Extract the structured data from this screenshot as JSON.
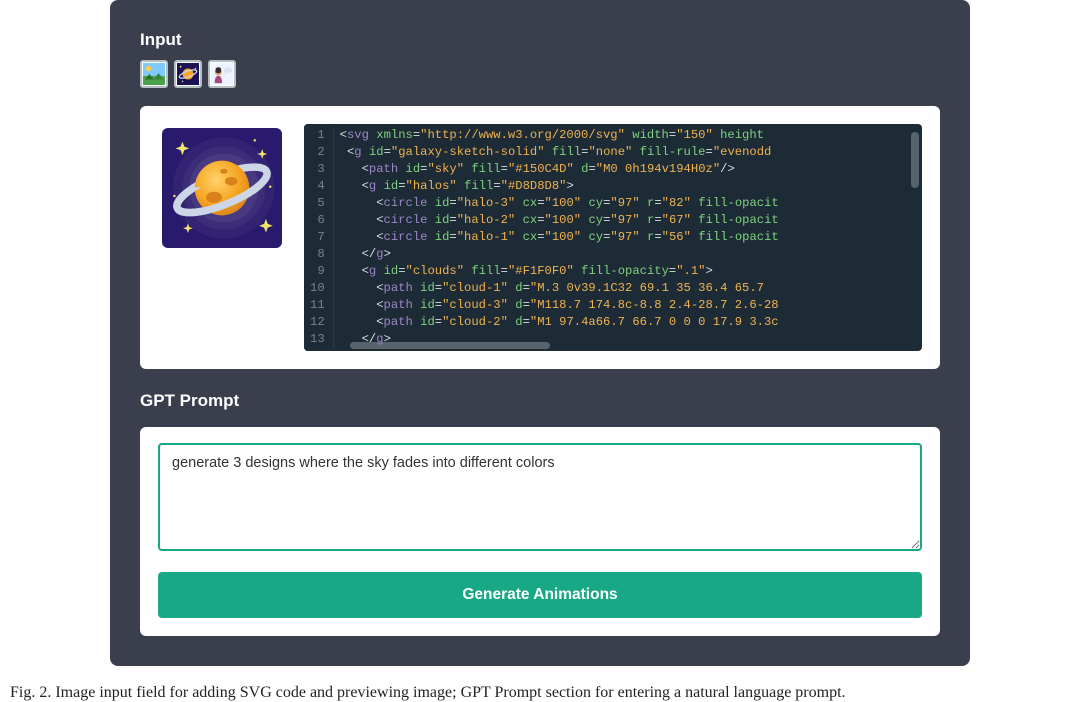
{
  "sections": {
    "input_label": "Input",
    "prompt_label": "GPT Prompt"
  },
  "thumbs": {
    "t1_name": "landscape-scene-icon",
    "t2_name": "galaxy-planet-icon",
    "t3_name": "person-speech-icon"
  },
  "code": {
    "line_numbers": [
      "1",
      "2",
      "3",
      "4",
      "5",
      "6",
      "7",
      "8",
      "9",
      "10",
      "11",
      "12",
      "13"
    ],
    "lines_plain": [
      "<svg xmlns=\"http://www.w3.org/2000/svg\" width=\"150\" height",
      " <g id=\"galaxy-sketch-solid\" fill=\"none\" fill-rule=\"evenodd",
      "   <path id=\"sky\" fill=\"#150C4D\" d=\"M0 0h194v194H0z\"/>",
      "   <g id=\"halos\" fill=\"#D8D8D8\">",
      "     <circle id=\"halo-3\" cx=\"100\" cy=\"97\" r=\"82\" fill-opacit",
      "     <circle id=\"halo-2\" cx=\"100\" cy=\"97\" r=\"67\" fill-opacit",
      "     <circle id=\"halo-1\" cx=\"100\" cy=\"97\" r=\"56\" fill-opacit",
      "   </g>",
      "   <g id=\"clouds\" fill=\"#F1F0F0\" fill-opacity=\".1\">",
      "     <path id=\"cloud-1\" d=\"M.3 0v39.1C32 69.1 35 36.4 65.7 ",
      "     <path id=\"cloud-3\" d=\"M118.7 174.8c-8.8 2.4-28.7 2.6-28",
      "     <path id=\"cloud-2\" d=\"M1 97.4a66.7 66.7 0 0 0 17.9 3.3c",
      "   </g>"
    ]
  },
  "prompt": {
    "value": "generate 3 designs where the sky fades into different colors"
  },
  "buttons": {
    "generate": "Generate Animations"
  },
  "caption": "Fig. 2.  Image input field for adding SVG code and previewing image; GPT Prompt section for entering a natural language prompt."
}
